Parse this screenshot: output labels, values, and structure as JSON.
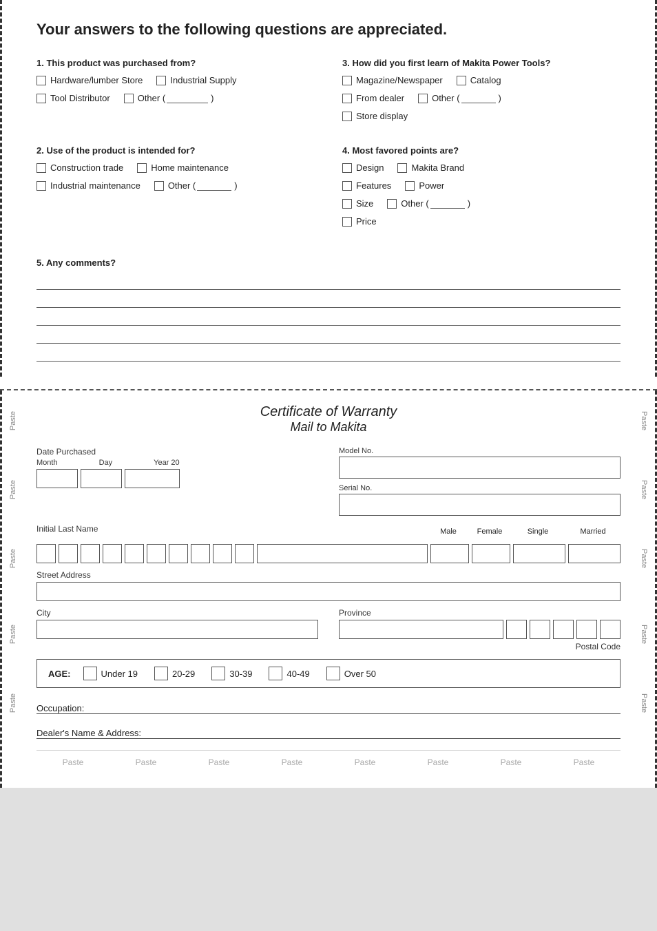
{
  "title": "Your answers to the following questions are appreciated.",
  "questions": {
    "q1": {
      "label": "1. This product was purchased from?",
      "options": [
        [
          "Hardware/lumber Store",
          "Industrial Supply"
        ],
        [
          "Tool Distributor",
          "Other (",
          ")"
        ]
      ]
    },
    "q2": {
      "label": "2. Use of the product is intended for?",
      "options": [
        [
          "Construction trade",
          "Home maintenance"
        ],
        [
          "Industrial maintenance",
          "Other (",
          ")"
        ]
      ]
    },
    "q3": {
      "label": "3. How did you first learn of Makita Power Tools?",
      "options": [
        [
          "Magazine/Newspaper",
          "Catalog"
        ],
        [
          "From dealer",
          "Other (",
          ")"
        ],
        [
          "Store display"
        ]
      ]
    },
    "q4": {
      "label": "4. Most favored points are?",
      "options": [
        [
          "Design",
          "Makita Brand"
        ],
        [
          "Features",
          "Power"
        ],
        [
          "Size",
          "Other (",
          ")"
        ],
        [
          "Price"
        ]
      ]
    },
    "q5": {
      "label": "5. Any comments?"
    }
  },
  "warranty": {
    "title": "Certificate of Warranty",
    "subtitle": "Mail to Makita",
    "date_purchased_label": "Date Purchased",
    "month_label": "Month",
    "day_label": "Day",
    "year_label": "Year 20",
    "model_label": "Model No.",
    "serial_label": "Serial No.",
    "initial_last_label": "Initial Last Name",
    "male_label": "Male",
    "female_label": "Female",
    "single_label": "Single",
    "married_label": "Married",
    "street_label": "Street Address",
    "city_label": "City",
    "province_label": "Province",
    "postal_label": "Postal Code",
    "age_label": "AGE:",
    "age_options": [
      "Under 19",
      "20-29",
      "30-39",
      "40-49",
      "Over 50"
    ],
    "occupation_label": "Occupation:",
    "dealer_label": "Dealer's Name & Address:",
    "paste_items": [
      "Paste",
      "Paste",
      "Paste",
      "Paste",
      "Paste",
      "Paste",
      "Paste",
      "Paste"
    ]
  }
}
